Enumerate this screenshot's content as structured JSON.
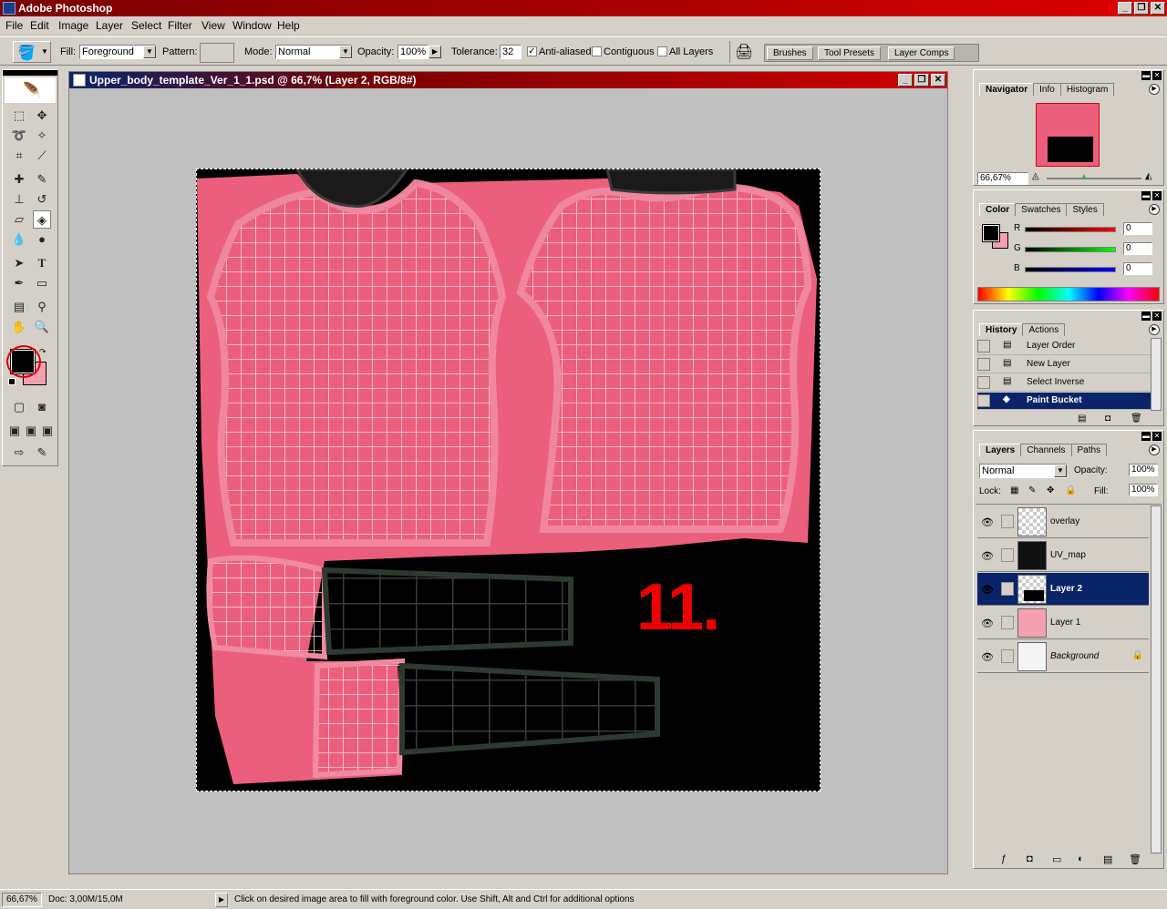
{
  "app": {
    "title": "Adobe Photoshop"
  },
  "menu": [
    "File",
    "Edit",
    "Image",
    "Layer",
    "Select",
    "Filter",
    "View",
    "Window",
    "Help"
  ],
  "options": {
    "fill_label": "Fill:",
    "fill_value": "Foreground",
    "pattern_label": "Pattern:",
    "mode_label": "Mode:",
    "mode_value": "Normal",
    "opacity_label": "Opacity:",
    "opacity_value": "100%",
    "tolerance_label": "Tolerance:",
    "tolerance_value": "32",
    "antialiased_label": "Anti-aliased",
    "antialiased_checked": true,
    "contiguous_label": "Contiguous",
    "contiguous_checked": false,
    "all_layers_label": "All Layers",
    "all_layers_checked": false,
    "well_tabs": [
      "Brushes",
      "Tool Presets",
      "Layer Comps"
    ]
  },
  "document": {
    "title": "Upper_body_template_Ver_1_1.psd @ 66,7% (Layer 2, RGB/8#)",
    "overlay_text": "11."
  },
  "navigator": {
    "tabs": [
      "Navigator",
      "Info",
      "Histogram"
    ],
    "zoom": "66,67%"
  },
  "color": {
    "tabs": [
      "Color",
      "Swatches",
      "Styles"
    ],
    "channels": [
      {
        "label": "R",
        "value": "0"
      },
      {
        "label": "G",
        "value": "0"
      },
      {
        "label": "B",
        "value": "0"
      }
    ],
    "foreground": "#000000",
    "background": "#f4a0b0"
  },
  "history": {
    "tabs": [
      "History",
      "Actions"
    ],
    "items": [
      "Layer Order",
      "New Layer",
      "Select Inverse",
      "Paint Bucket"
    ],
    "selected_index": 3
  },
  "layers": {
    "tabs": [
      "Layers",
      "Channels",
      "Paths"
    ],
    "blend_mode": "Normal",
    "opacity_label": "Opacity:",
    "opacity": "100%",
    "lock_label": "Lock:",
    "fill_label": "Fill:",
    "fill": "100%",
    "items": [
      "overlay",
      "UV_map",
      "Layer 2",
      "Layer 1",
      "Background"
    ],
    "selected_index": 2
  },
  "status": {
    "zoom": "66,67%",
    "doc": "Doc: 3,00M/15,0M",
    "hint": "Click on desired image area to fill with foreground color.  Use Shift, Alt and Ctrl for additional options"
  },
  "colors": {
    "accent_selection": "#0a246a",
    "paint_pink": "#ec5f7c",
    "title_red": "#c00000"
  }
}
